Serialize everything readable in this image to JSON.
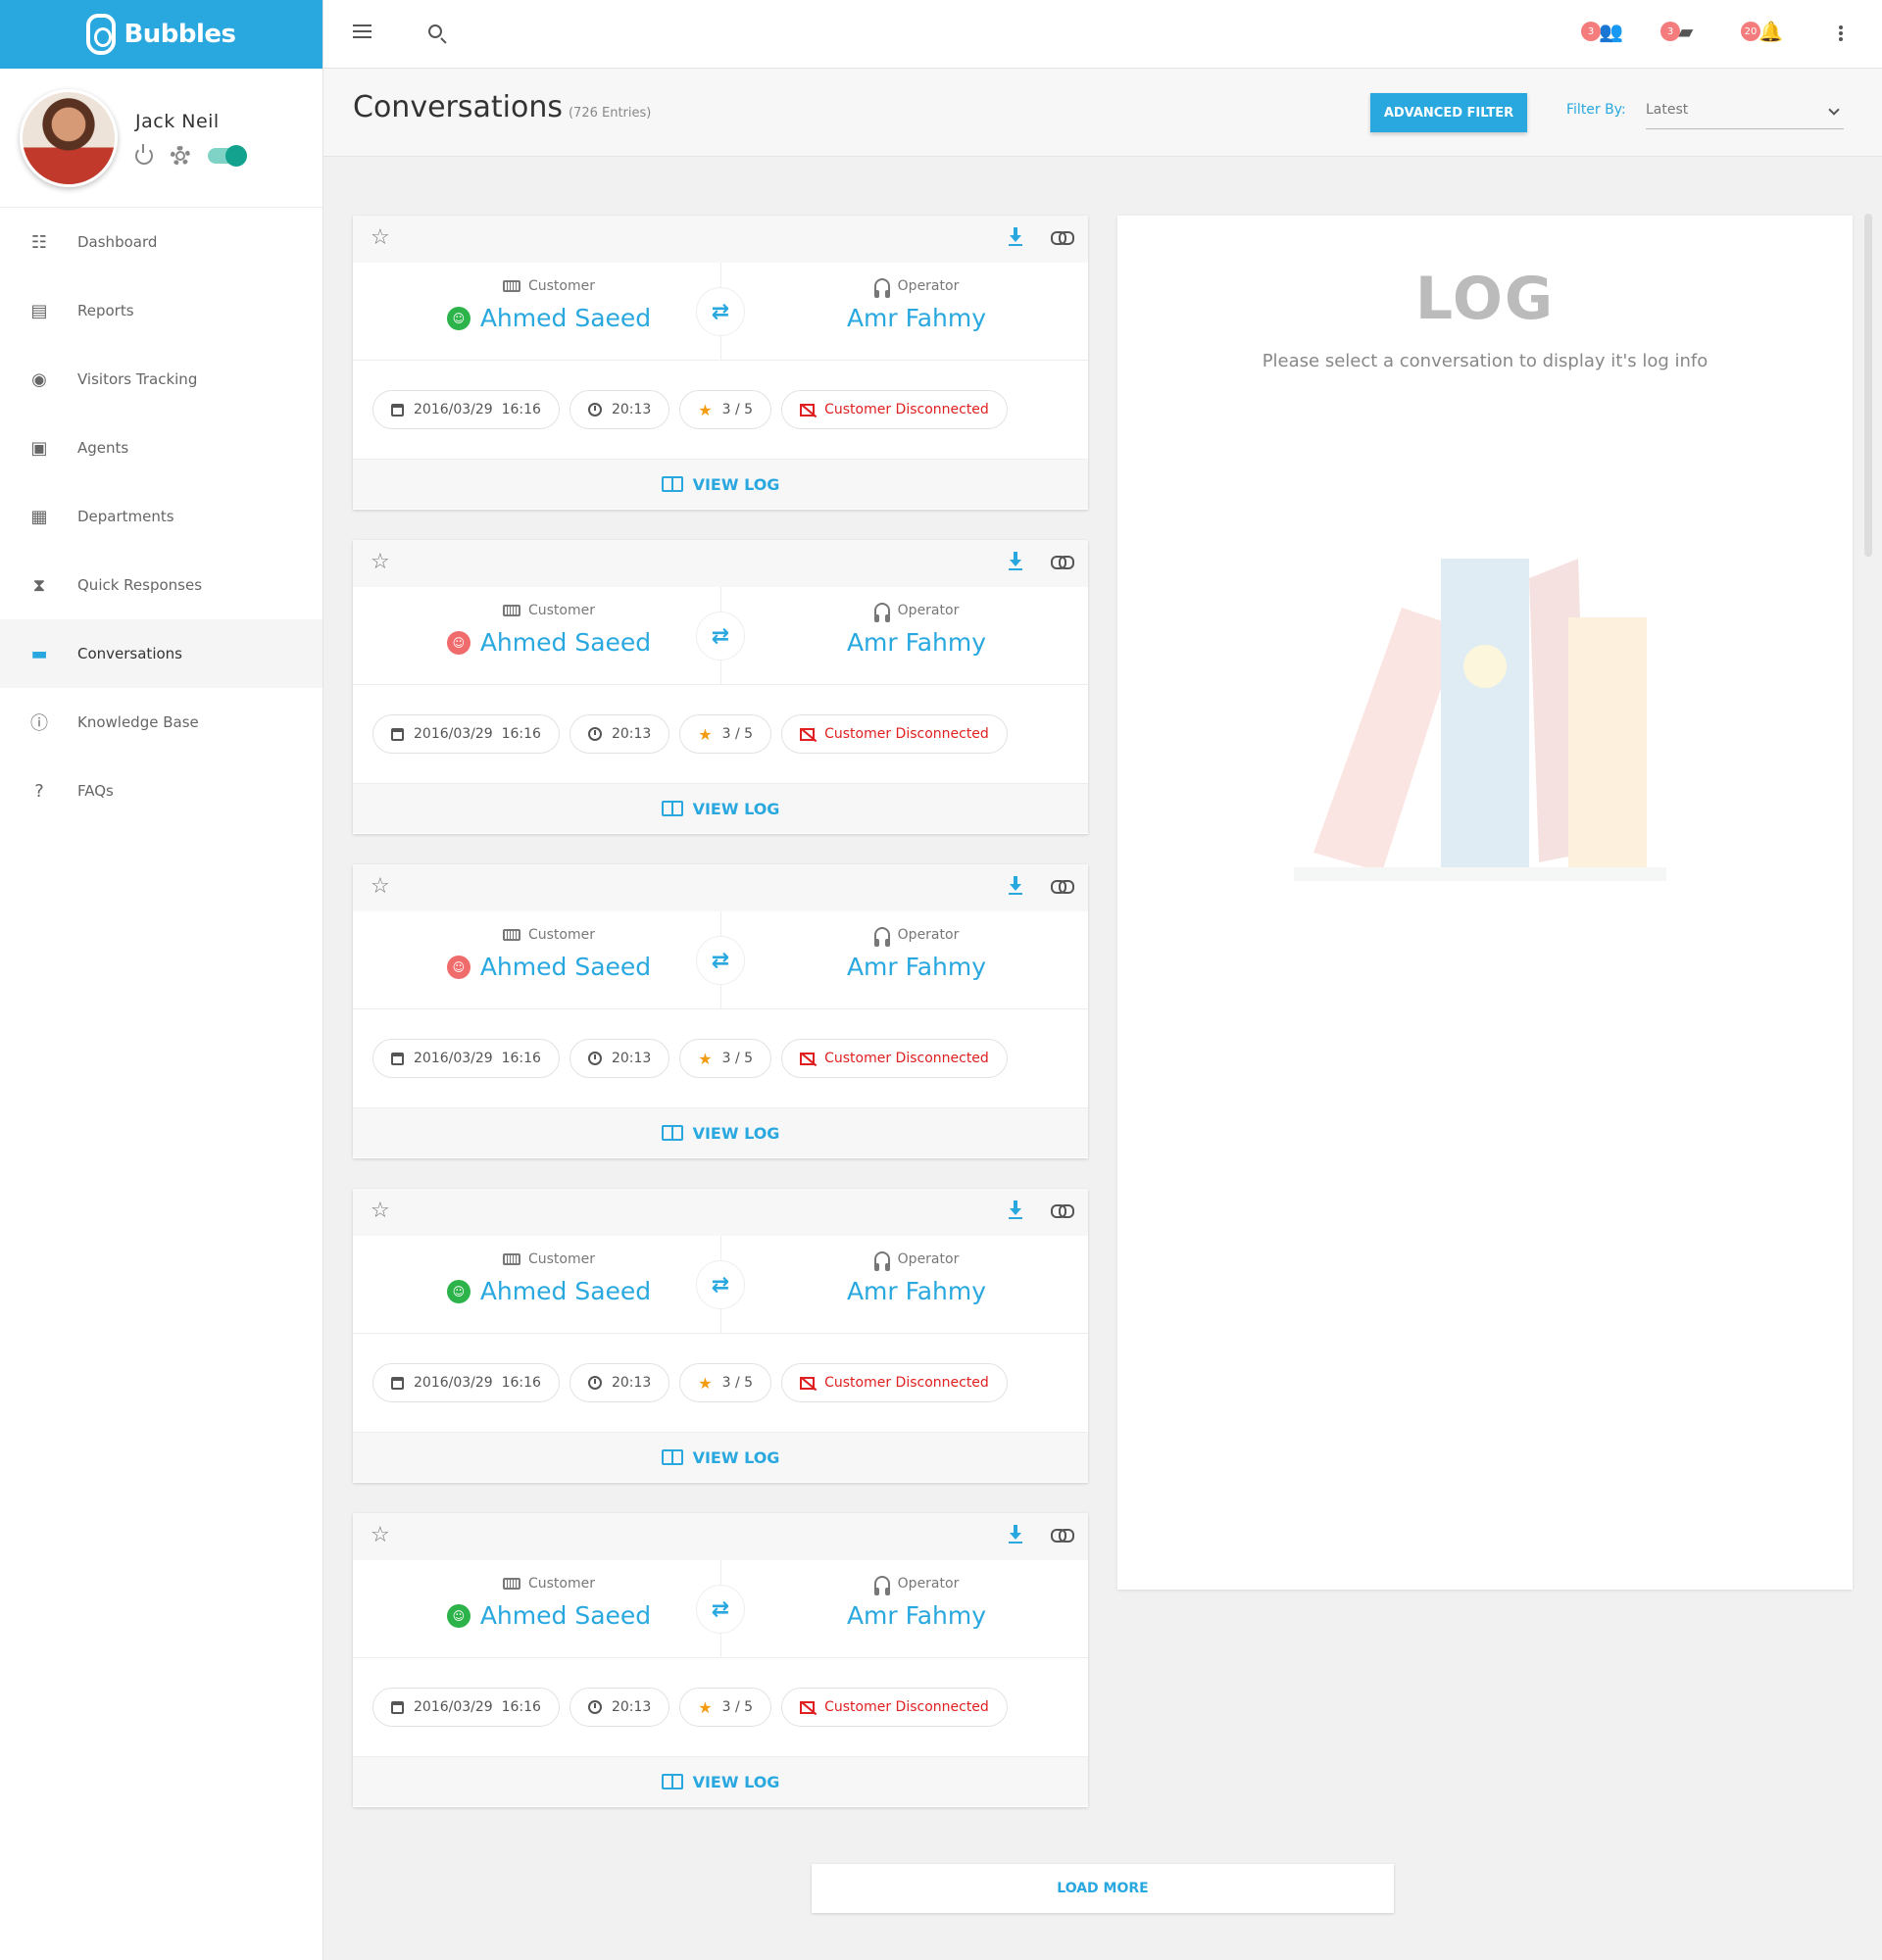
{
  "brand": {
    "name": "Bubbles"
  },
  "profile": {
    "name": "Jack Neil"
  },
  "sidebar": {
    "items": [
      {
        "label": "Dashboard",
        "icon": "sliders-icon"
      },
      {
        "label": "Reports",
        "icon": "clipboard-icon"
      },
      {
        "label": "Visitors Tracking",
        "icon": "compass-icon"
      },
      {
        "label": "Agents",
        "icon": "contact-icon"
      },
      {
        "label": "Departments",
        "icon": "grid-icon"
      },
      {
        "label": "Quick Responses",
        "icon": "hourglass-icon"
      },
      {
        "label": "Conversations",
        "icon": "chat-icon",
        "active": true
      },
      {
        "label": "Knowledge Base",
        "icon": "info-icon"
      },
      {
        "label": "FAQs",
        "icon": "help-icon"
      }
    ]
  },
  "topbar": {
    "notifications": [
      {
        "count": "3",
        "icon": "people-icon"
      },
      {
        "count": "3",
        "icon": "message-icon"
      },
      {
        "count": "20",
        "icon": "bell-icon"
      }
    ]
  },
  "header": {
    "title": "Conversations",
    "count": "(726 Entries)",
    "advanced_filter": "ADVANCED FILTER",
    "filter_label": "Filter By:",
    "filter_value": "Latest"
  },
  "cards": [
    {
      "customer_label": "Customer",
      "customer_name": "Ahmed Saeed",
      "customer_status": "online",
      "operator_label": "Operator",
      "operator_name": "Amr Fahmy",
      "date": "2016/03/29  16:16",
      "duration": "20:13",
      "rating": "3 / 5",
      "status": "Customer Disconnected",
      "view_log": "VIEW LOG"
    },
    {
      "customer_label": "Customer",
      "customer_name": "Ahmed Saeed",
      "customer_status": "offline",
      "operator_label": "Operator",
      "operator_name": "Amr Fahmy",
      "date": "2016/03/29  16:16",
      "duration": "20:13",
      "rating": "3 / 5",
      "status": "Customer Disconnected",
      "view_log": "VIEW LOG"
    },
    {
      "customer_label": "Customer",
      "customer_name": "Ahmed Saeed",
      "customer_status": "offline",
      "operator_label": "Operator",
      "operator_name": "Amr Fahmy",
      "date": "2016/03/29  16:16",
      "duration": "20:13",
      "rating": "3 / 5",
      "status": "Customer Disconnected",
      "view_log": "VIEW LOG"
    },
    {
      "customer_label": "Customer",
      "customer_name": "Ahmed Saeed",
      "customer_status": "online",
      "operator_label": "Operator",
      "operator_name": "Amr Fahmy",
      "date": "2016/03/29  16:16",
      "duration": "20:13",
      "rating": "3 / 5",
      "status": "Customer Disconnected",
      "view_log": "VIEW LOG"
    },
    {
      "customer_label": "Customer",
      "customer_name": "Ahmed Saeed",
      "customer_status": "online",
      "operator_label": "Operator",
      "operator_name": "Amr Fahmy",
      "date": "2016/03/29  16:16",
      "duration": "20:13",
      "rating": "3 / 5",
      "status": "Customer Disconnected",
      "view_log": "VIEW LOG"
    }
  ],
  "load_more": "LOAD MORE",
  "log": {
    "title": "LOG",
    "subtitle": "Please select a conversation to display it's log info"
  },
  "colors": {
    "accent": "#29a8e0",
    "online": "#2cb34a",
    "offline": "#f06b6b",
    "danger": "#e02020",
    "rating": "#f39c12"
  }
}
